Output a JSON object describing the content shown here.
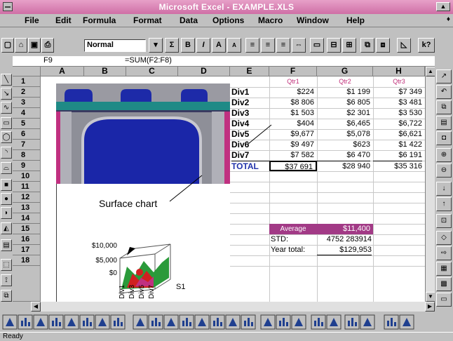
{
  "window": {
    "title": "Microsoft Excel - EXAMPLE.XLS",
    "controls": "▲"
  },
  "menu": [
    "File",
    "Edit",
    "Formula",
    "Format",
    "Data",
    "Options",
    "Macro",
    "Window",
    "Help"
  ],
  "document_controls": "♦",
  "toolbar": {
    "style": "Normal",
    "sum_label": "Σ",
    "bold_label": "B",
    "italic_label": "I",
    "help_label": "k?"
  },
  "formula_bar": {
    "cell_ref": "F9",
    "formula": "=SUM(F2:F8)"
  },
  "columns": [
    "A",
    "B",
    "C",
    "D",
    "E",
    "F",
    "G",
    "H"
  ],
  "rows": [
    "1",
    "2",
    "3",
    "4",
    "5",
    "6",
    "7",
    "8",
    "9",
    "10",
    "11",
    "12",
    "13",
    "14",
    "15",
    "16",
    "17",
    "18"
  ],
  "quarters": [
    "Qtr1",
    "Qtr2",
    "Qtr3"
  ],
  "divisions": [
    {
      "label": "Div1",
      "q1": "$224",
      "q2": "$1 199",
      "q3": "$7 349"
    },
    {
      "label": "Div2",
      "q1": "$8 806",
      "q2": "$6 805",
      "q3": "$3 481"
    },
    {
      "label": "Div3",
      "q1": "$1 503",
      "q2": "$2 301",
      "q3": "$3 530"
    },
    {
      "label": "Div4",
      "q1": "$404",
      "q2": "$6,465",
      "q3": "$6,722"
    },
    {
      "label": "Div5",
      "q1": "$9,677",
      "q2": "$5,078",
      "q3": "$6,621"
    },
    {
      "label": "Div6",
      "q1": "$9 497",
      "q2": "$623",
      "q3": "$1 422"
    },
    {
      "label": "Div7",
      "q1": "$7 582",
      "q2": "$6 470",
      "q3": "$6 191"
    }
  ],
  "total": {
    "label": "TOTAL",
    "q1": "$37 691",
    "q2": "$28 940",
    "q3": "$35 316"
  },
  "stats": {
    "average_label": "Average",
    "average_value": "$11,400",
    "std_label": "STD:",
    "std_value": "4752 283914",
    "year_label": "Year total:",
    "year_value": "$129,953"
  },
  "chart_data": {
    "type": "area",
    "title": "Surface chart",
    "y_tick_labels": [
      "$10,000",
      "$5,000",
      "$0"
    ],
    "x_tick_labels": [
      "Div1",
      "Div3",
      "Div5",
      "Div7"
    ],
    "series_label": "S1",
    "colors": [
      "#2a9a3a",
      "#d02020",
      "#c03080",
      "#1a4dbf"
    ]
  },
  "status": "Ready",
  "colors": {
    "title_bar": "#d77fb3",
    "quarter_header": "#c0307a",
    "total_text": "#2233aa",
    "average_fill": "#a23a86"
  }
}
